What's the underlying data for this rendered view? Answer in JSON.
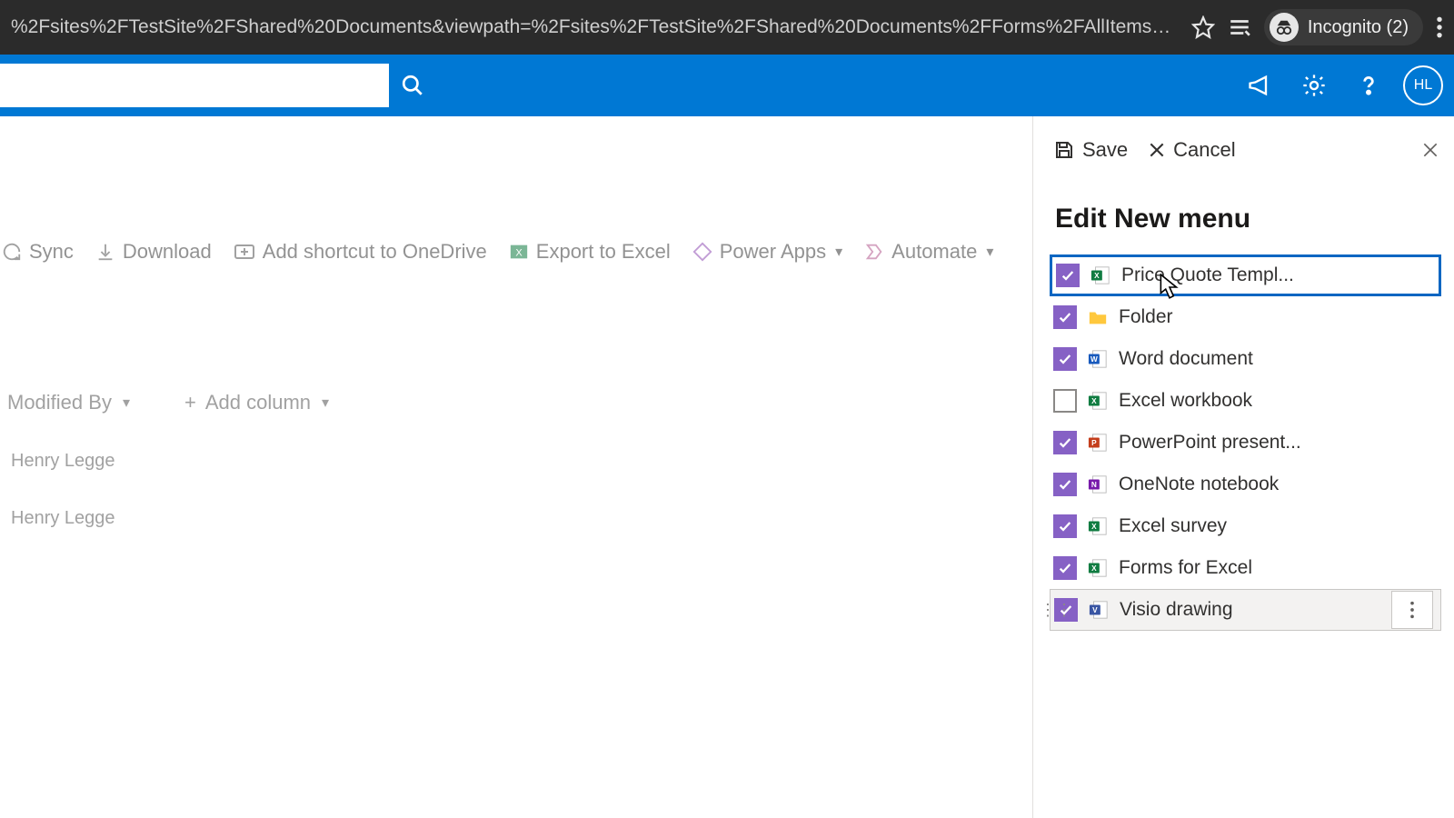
{
  "browser": {
    "url": "%2Fsites%2FTestSite%2FShared%20Documents&viewpath=%2Fsites%2FTestSite%2FShared%20Documents%2FForms%2FAllItems%2E...",
    "incognito_label": "Incognito (2)"
  },
  "header": {
    "avatar": "HL"
  },
  "commands": {
    "sync": "Sync",
    "download": "Download",
    "shortcut": "Add shortcut to OneDrive",
    "export": "Export to Excel",
    "powerapps": "Power Apps",
    "automate": "Automate"
  },
  "columns": {
    "modified_by": "Modified By",
    "add_column": "Add column"
  },
  "rows": [
    "Henry Legge",
    "Henry Legge"
  ],
  "panel": {
    "save": "Save",
    "cancel": "Cancel",
    "title": "Edit New menu",
    "items": [
      {
        "label": "Price Quote Templ...",
        "checked": true,
        "selected": true,
        "icon": "excel"
      },
      {
        "label": "Folder",
        "checked": true,
        "selected": false,
        "icon": "folder"
      },
      {
        "label": "Word document",
        "checked": true,
        "selected": false,
        "icon": "word"
      },
      {
        "label": "Excel workbook",
        "checked": false,
        "selected": false,
        "icon": "excel"
      },
      {
        "label": "PowerPoint present...",
        "checked": true,
        "selected": false,
        "icon": "ppt"
      },
      {
        "label": "OneNote notebook",
        "checked": true,
        "selected": false,
        "icon": "onenote"
      },
      {
        "label": "Excel survey",
        "checked": true,
        "selected": false,
        "icon": "excel"
      },
      {
        "label": "Forms for Excel",
        "checked": true,
        "selected": false,
        "icon": "excel"
      },
      {
        "label": "Visio drawing",
        "checked": true,
        "selected": false,
        "icon": "visio",
        "hover": true
      }
    ]
  }
}
